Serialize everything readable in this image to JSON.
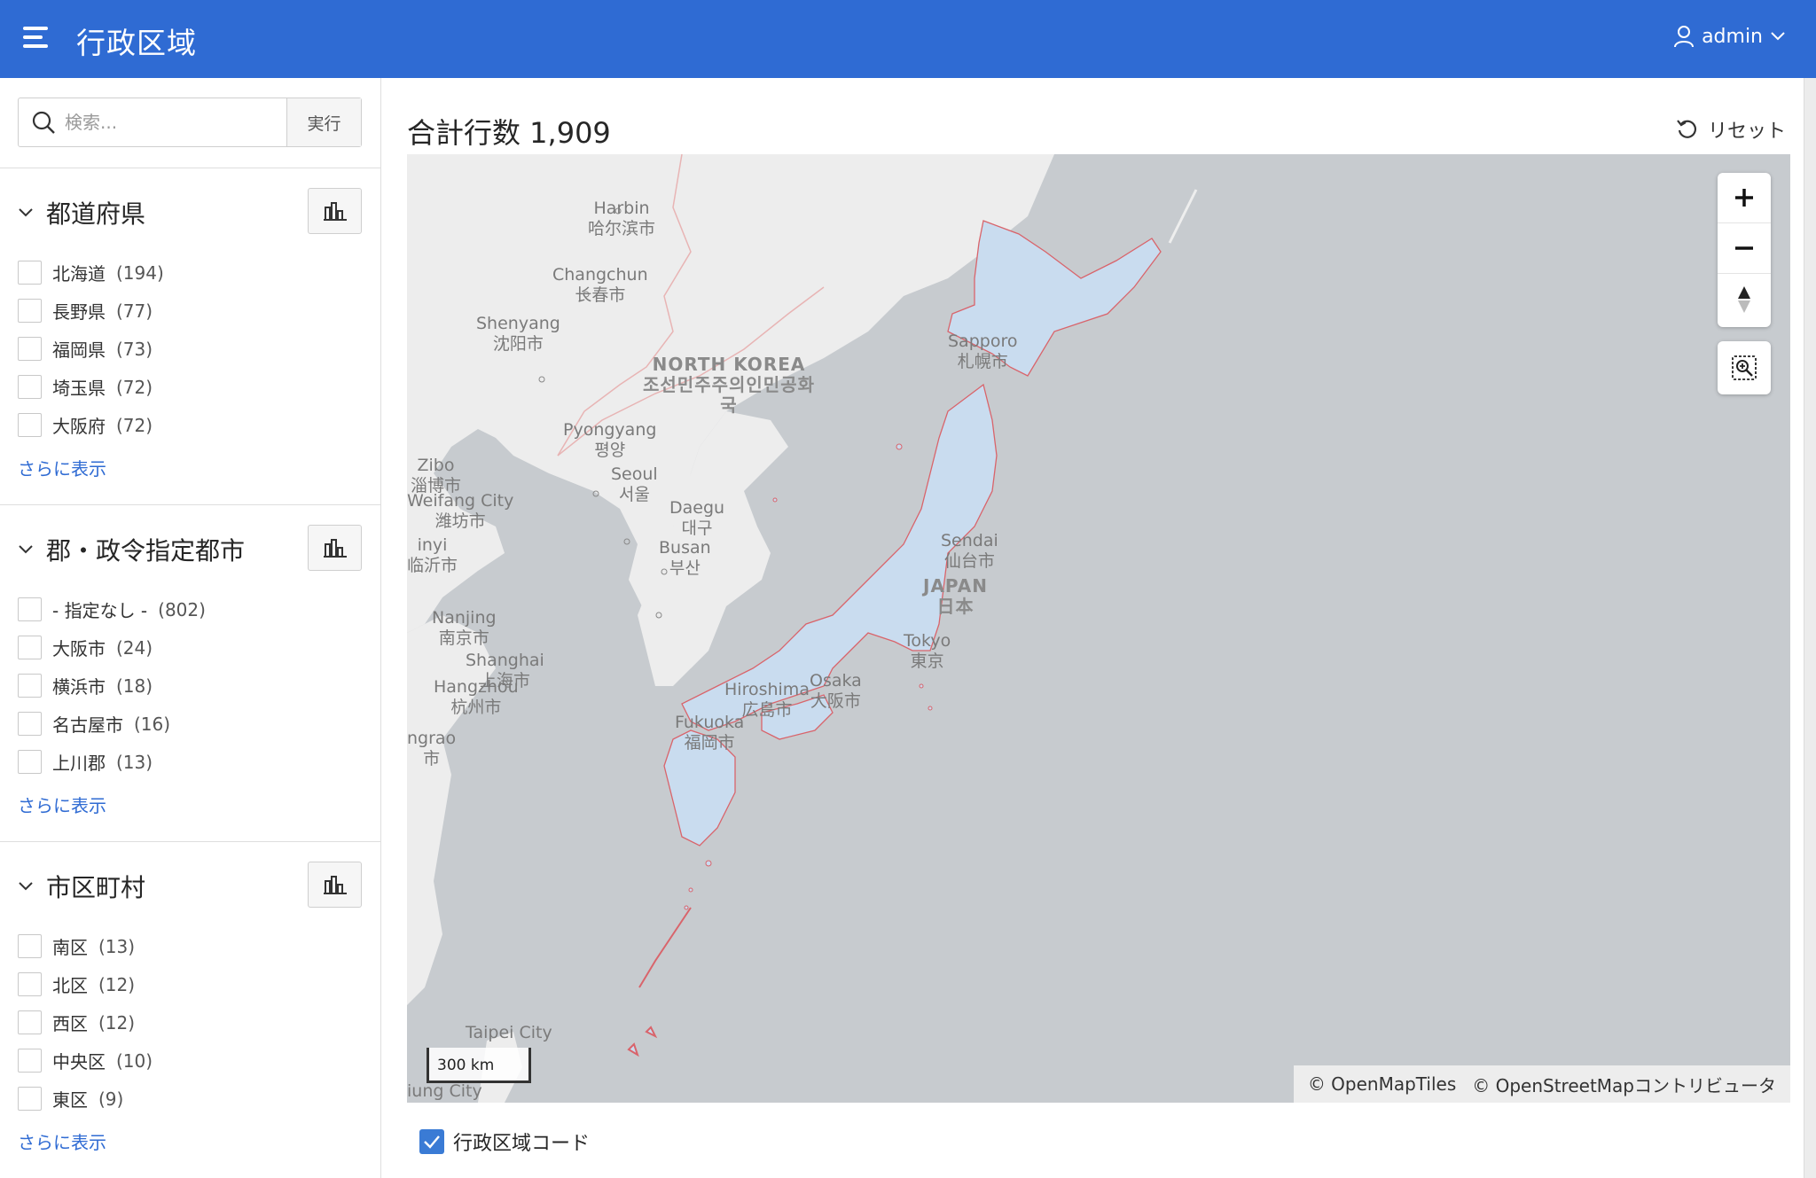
{
  "header": {
    "title": "行政区域",
    "user": "admin"
  },
  "search": {
    "placeholder": "検索...",
    "run_label": "実行"
  },
  "facets": [
    {
      "title": "都道府県",
      "items": [
        {
          "label": "北海道",
          "count": "(194)"
        },
        {
          "label": "長野県",
          "count": "(77)"
        },
        {
          "label": "福岡県",
          "count": "(73)"
        },
        {
          "label": "埼玉県",
          "count": "(72)"
        },
        {
          "label": "大阪府",
          "count": "(72)"
        }
      ],
      "more": "さらに表示"
    },
    {
      "title": "郡・政令指定都市",
      "items": [
        {
          "label": "- 指定なし -",
          "count": "(802)"
        },
        {
          "label": "大阪市",
          "count": "(24)"
        },
        {
          "label": "横浜市",
          "count": "(18)"
        },
        {
          "label": "名古屋市",
          "count": "(16)"
        },
        {
          "label": "上川郡",
          "count": "(13)"
        }
      ],
      "more": "さらに表示"
    },
    {
      "title": "市区町村",
      "items": [
        {
          "label": "南区",
          "count": "(13)"
        },
        {
          "label": "北区",
          "count": "(12)"
        },
        {
          "label": "西区",
          "count": "(12)"
        },
        {
          "label": "中央区",
          "count": "(10)"
        },
        {
          "label": "東区",
          "count": "(9)"
        }
      ],
      "more": "さらに表示"
    }
  ],
  "main": {
    "total_rows": "合計行数 1,909",
    "reset_label": "リセット"
  },
  "map": {
    "labels": {
      "harbin": "Harbin\n哈尔滨市",
      "changchun": "Changchun\n长春市",
      "shenyang": "Shenyang\n沈阳市",
      "north_korea": "NORTH KOREA\n조선민주주의인민공화\n국",
      "pyongyang": "Pyongyang\n평양",
      "seoul": "Seoul\n서울",
      "daegu": "Daegu\n대구",
      "busan": "Busan\n부산",
      "zibo": "Zibo\n淄博市",
      "weifang": "Weifang City\n潍坊市",
      "linyi": "inyi\n临沂市",
      "nanjing": "Nanjing\n南京市",
      "shanghai": "Shanghai\n上海市",
      "hangzhou": "Hangzhou\n杭州市",
      "ningbo": "ngrao\n市",
      "taipei": "Taipei City",
      "keelung": "iung City",
      "sapporo": "Sapporo\n札幌市",
      "sendai": "Sendai\n仙台市",
      "japan": "JAPAN\n日本",
      "tokyo": "Tokyo\n東京",
      "osaka": "Osaka\n大阪市",
      "hiroshima": "Hiroshima\n広島市",
      "fukuoka": "Fukuoka\n福岡市"
    },
    "scale": "300 km",
    "attribution_1": "© OpenMapTiles",
    "attribution_2": "© OpenStreetMapコントリビュータ",
    "legend_label": "行政区域コード"
  },
  "colors": {
    "header": "#2f6bd3",
    "link": "#2f6bd3",
    "sea": "#c7cbcf",
    "land": "#ededed",
    "region_fill": "#c9dcef",
    "region_border": "#d9646b"
  }
}
